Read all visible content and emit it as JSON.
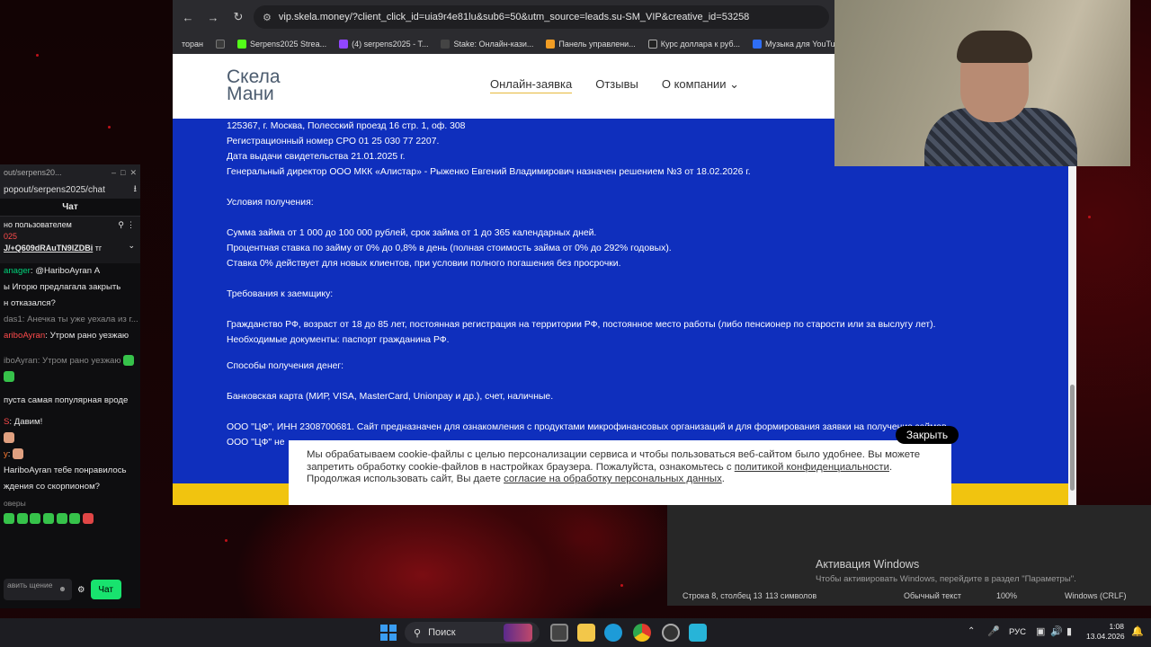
{
  "browser": {
    "url": "vip.skela.money/?client_click_id=uia9r4e81lu&sub6=50&utm_source=leads.su-SM_VIP&creative_id=53258",
    "bookmarks": [
      "торан",
      "Serpens2025 Strea...",
      "(4) serpens2025 - T...",
      "Stake: Онлайн-кази...",
      "Панель управлени...",
      "Курс доллара к руб...",
      "Музыка для YouTu..."
    ]
  },
  "site": {
    "logo_line1": "Скела",
    "logo_line2": "Мани",
    "nav": [
      "Онлайн-заявка",
      "Отзывы",
      "О компании"
    ],
    "content_lines": [
      "125367, г. Москва, Полесский проезд 16 стр. 1, оф. 308",
      "Регистрационный номер СРО 01 25 030 77 2207.",
      "Дата выдачи свидетельства 21.01.2025 г.",
      "Генеральный директор ООО МКК «Алистар» - Рыженко Евгений Владимирович назначен решением №3 от 18.02.2026 г.",
      "",
      "Условия получения:",
      "",
      "Сумма займа от 1 000 до 100 000 рублей, срок займа от 1 до 365 календарных дней.",
      "Процентная ставка по займу от 0% до 0,8% в день (полная стоимость займа от 0% до 292% годовых).",
      "Ставка 0% действует для новых клиентов, при условии полного погашения без просрочки.",
      "",
      "Требования к заемщику:",
      "",
      "Гражданство РФ, возраст от 18 до 85 лет, постоянная регистрация на территории РФ, постоянное место работы (либо пенсионер по старости или за выслугу лет).",
      "Необходимые документы: паспорт гражданина РФ.",
      "",
      "Способы получения денег:",
      "",
      "Банковская карта (МИР, VISA, MasterCard, Unionpay и др.), счет, наличные.",
      "",
      "ООО \"ЦФ\", ИНН 2308700681. Сайт предназначен для ознакомления с продуктами микрофинансовых организаций и для формирования заявки на получение займов.",
      "ООО \"ЦФ\" не"
    ]
  },
  "cookie": {
    "text1": "Мы обрабатываем cookie-файлы с целью персонализации сервиса и чтобы пользоваться веб-сайтом было удобнее. Вы можете запретить обработку cookie-файлов в настройках браузера. Пожалуйста, ознакомьтесь с ",
    "link1": "политикой конфиденциальности",
    "text2": ". Продолжая использовать сайт, Вы даете ",
    "link2": "согласие на обработку персональных данных",
    "text3": ".",
    "close": "Закрыть"
  },
  "chat": {
    "window_title": "out/serpens20...",
    "url": "popout/serpens2025/chat",
    "header": "Чат",
    "pinned_top": "но пользователем",
    "pinned_user": "025",
    "pinned_link": "J/+Q609dRAuTN9lZDBi",
    "pinned_suffix": "тг",
    "messages": [
      {
        "nick": "anager",
        "text": ": @HariboAyran А",
        "color": "g"
      },
      {
        "nick": "",
        "text": "ы Игорю предлагала закрыть",
        "color": ""
      },
      {
        "nick": "",
        "text": "н отказался?",
        "color": ""
      },
      {
        "nick": "das1: Анечка ты уже уехала из г...",
        "text": "",
        "color": "dim"
      },
      {
        "nick": "ariboAyran",
        "text": ": Утром рано уезжаю",
        "color": "r"
      },
      {
        "nick": "iboAyran: Утром рано уезжаю",
        "text": "",
        "color": "dim"
      },
      {
        "nick": "",
        "text": "пуста самая популярная вроде",
        "color": ""
      },
      {
        "nick": "S",
        "text": ": Давим!",
        "color": "r"
      },
      {
        "nick": "y",
        "text": ":",
        "color": "o"
      },
      {
        "nick": "",
        "text": "HariboAyran тебе понравилось",
        "color": ""
      },
      {
        "nick": "",
        "text": "ждения со скорпионом?",
        "color": ""
      },
      {
        "nick": "оверы",
        "text": "",
        "color": "dim"
      }
    ],
    "input_placeholder": "авить щение",
    "send": "Чат"
  },
  "notepad": {
    "position": "Строка 8, столбец 13",
    "chars": "113 символов",
    "format": "Обычный текст",
    "zoom": "100%",
    "encoding": "Windows (CRLF)"
  },
  "activation": {
    "title": "Активация Windows",
    "subtitle": "Чтобы активировать Windows, перейдите в раздел \"Параметры\"."
  },
  "taskbar": {
    "search": "Поиск",
    "lang": "РУС",
    "time": "1:08",
    "date": "13.04.2026"
  },
  "colors": {
    "site_blue": "#0f2fbd",
    "site_yellow": "#f1c40f",
    "accent_gold": "#e6b83b"
  }
}
